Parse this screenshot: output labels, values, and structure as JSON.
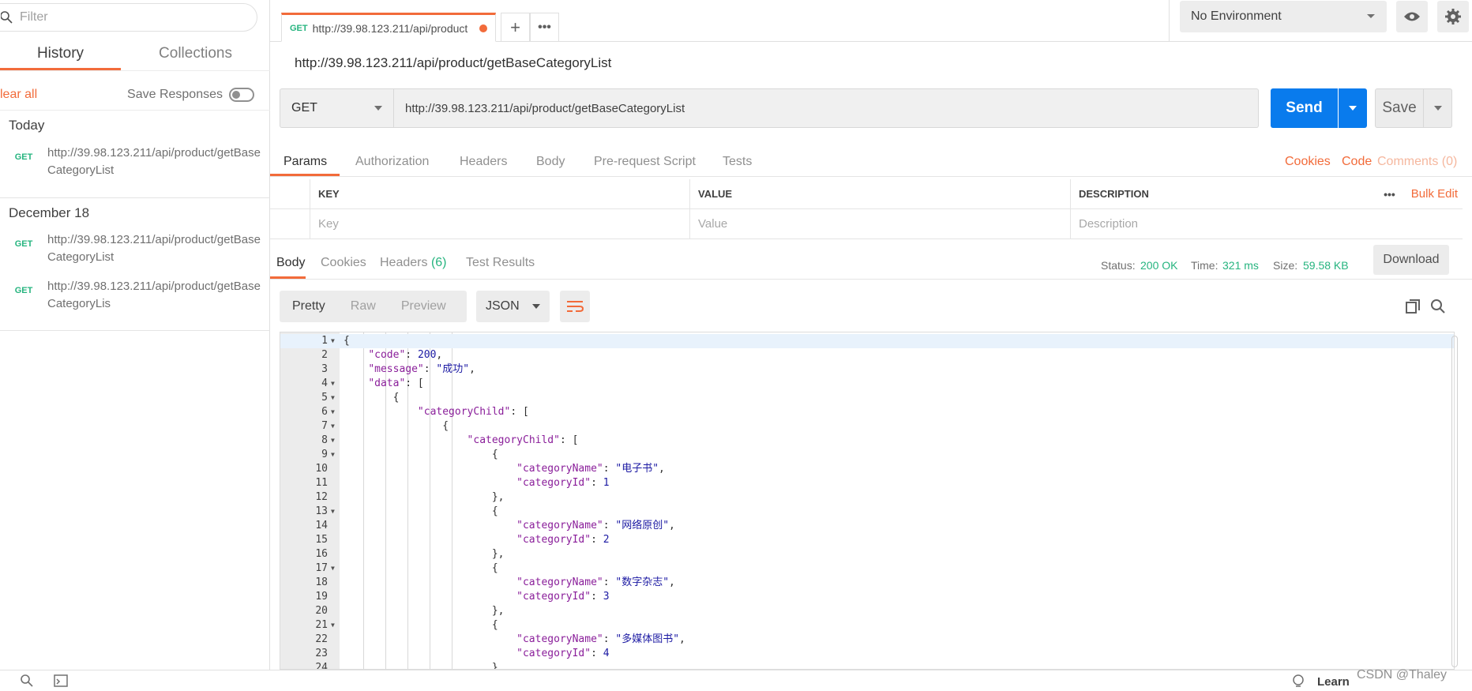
{
  "sidebar": {
    "filter_placeholder": "Filter",
    "tabs": [
      {
        "label": "History"
      },
      {
        "label": "Collections"
      }
    ],
    "clear_all": "lear all",
    "save_responses": "Save Responses",
    "groups": [
      {
        "title": "Today",
        "items": [
          {
            "method": "GET",
            "url": "http://39.98.123.211/api/product/getBaseCategoryList"
          }
        ]
      },
      {
        "title": "December 18",
        "items": [
          {
            "method": "GET",
            "url": "http://39.98.123.211/api/product/getBaseCategoryList"
          },
          {
            "method": "GET",
            "url": "http://39.98.123.211/api/product/getBaseCategoryLis"
          }
        ]
      }
    ]
  },
  "tab": {
    "method": "GET",
    "url": "http://39.98.123.211/api/product"
  },
  "environment": {
    "selected": "No Environment"
  },
  "request": {
    "title": "http://39.98.123.211/api/product/getBaseCategoryList",
    "method": "GET",
    "url": "http://39.98.123.211/api/product/getBaseCategoryList",
    "send": "Send",
    "save": "Save"
  },
  "request_tabs": [
    "Params",
    "Authorization",
    "Headers",
    "Body",
    "Pre-request Script",
    "Tests"
  ],
  "request_links": {
    "cookies": "Cookies",
    "code": "Code",
    "comments": "Comments (0)"
  },
  "params": {
    "headers": {
      "key": "KEY",
      "value": "VALUE",
      "description": "DESCRIPTION"
    },
    "bulk_edit": "Bulk Edit",
    "placeholders": {
      "key": "Key",
      "value": "Value",
      "description": "Description"
    }
  },
  "response_tabs": {
    "body": "Body",
    "cookies": "Cookies",
    "headers": "Headers",
    "headers_count": "(6)",
    "test_results": "Test Results"
  },
  "response_status": {
    "status_label": "Status:",
    "status": "200 OK",
    "time_label": "Time:",
    "time": "321 ms",
    "size_label": "Size:",
    "size": "59.58 KB",
    "download": "Download"
  },
  "format": {
    "pretty": "Pretty",
    "raw": "Raw",
    "preview": "Preview",
    "type": "JSON"
  },
  "code_lines": [
    "{",
    "    \"code\": 200,",
    "    \"message\": \"成功\",",
    "    \"data\": [",
    "        {",
    "            \"categoryChild\": [",
    "                {",
    "                    \"categoryChild\": [",
    "                        {",
    "                            \"categoryName\": \"电子书\",",
    "                            \"categoryId\": 1",
    "                        },",
    "                        {",
    "                            \"categoryName\": \"网络原创\",",
    "                            \"categoryId\": 2",
    "                        },",
    "                        {",
    "                            \"categoryName\": \"数字杂志\",",
    "                            \"categoryId\": 3",
    "                        },",
    "                        {",
    "                            \"categoryName\": \"多媒体图书\",",
    "                            \"categoryId\": 4",
    "                        }"
  ],
  "fold_lines": [
    1,
    4,
    5,
    6,
    7,
    8,
    9,
    13,
    17,
    21
  ],
  "footer": {
    "learn": "Learn"
  },
  "watermark": "CSDN @Thaley",
  "colors": {
    "accent": "#f26b3a",
    "send": "#097bed",
    "get": "#26b47f",
    "status_ok": "#26b47f"
  }
}
